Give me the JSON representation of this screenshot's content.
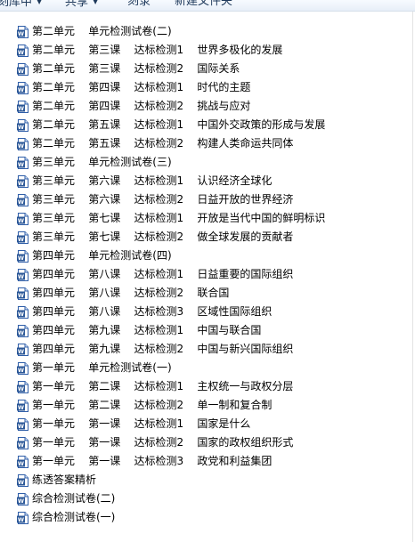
{
  "toolbar": {
    "items": [
      {
        "label": "刻库中",
        "has_menu": true
      },
      {
        "label": "共享",
        "has_menu": true
      },
      {
        "label": "刻录",
        "has_menu": false
      },
      {
        "label": "新建文件夹",
        "has_menu": false
      }
    ]
  },
  "file_icon": "word-document-icon",
  "files": [
    {
      "name": "第二单元    单元检测试卷(二)"
    },
    {
      "name": "第二单元    第三课    达标检测1    世界多极化的发展"
    },
    {
      "name": "第二单元    第三课    达标检测2    国际关系"
    },
    {
      "name": "第二单元    第四课    达标检测1    时代的主题"
    },
    {
      "name": "第二单元    第四课    达标检测2    挑战与应对"
    },
    {
      "name": "第二单元    第五课    达标检测1    中国外交政策的形成与发展"
    },
    {
      "name": "第二单元    第五课    达标检测2    构建人类命运共同体"
    },
    {
      "name": "第三单元    单元检测试卷(三)"
    },
    {
      "name": "第三单元    第六课    达标检测1    认识经济全球化"
    },
    {
      "name": "第三单元    第六课    达标检测2    日益开放的世界经济"
    },
    {
      "name": "第三单元    第七课    达标检测1    开放是当代中国的鲜明标识"
    },
    {
      "name": "第三单元    第七课    达标检测2    做全球发展的贡献者"
    },
    {
      "name": "第四单元    单元检测试卷(四)"
    },
    {
      "name": "第四单元    第八课    达标检测1    日益重要的国际组织"
    },
    {
      "name": "第四单元    第八课    达标检测2    联合国"
    },
    {
      "name": "第四单元    第八课    达标检测3    区域性国际组织"
    },
    {
      "name": "第四单元    第九课    达标检测1    中国与联合国"
    },
    {
      "name": "第四单元    第九课    达标检测2    中国与新兴国际组织"
    },
    {
      "name": "第一单元    单元检测试卷(一)"
    },
    {
      "name": "第一单元    第二课    达标检测1    主权统一与政权分层"
    },
    {
      "name": "第一单元    第二课    达标检测2    单一制和复合制"
    },
    {
      "name": "第一单元    第一课    达标检测1    国家是什么"
    },
    {
      "name": "第一单元    第一课    达标检测2    国家的政权组织形式"
    },
    {
      "name": "第一单元    第一课    达标检测3    政党和利益集团"
    },
    {
      "name": "练透答案精析"
    },
    {
      "name": "综合检测试卷(二)"
    },
    {
      "name": "综合检测试卷(一)"
    }
  ]
}
